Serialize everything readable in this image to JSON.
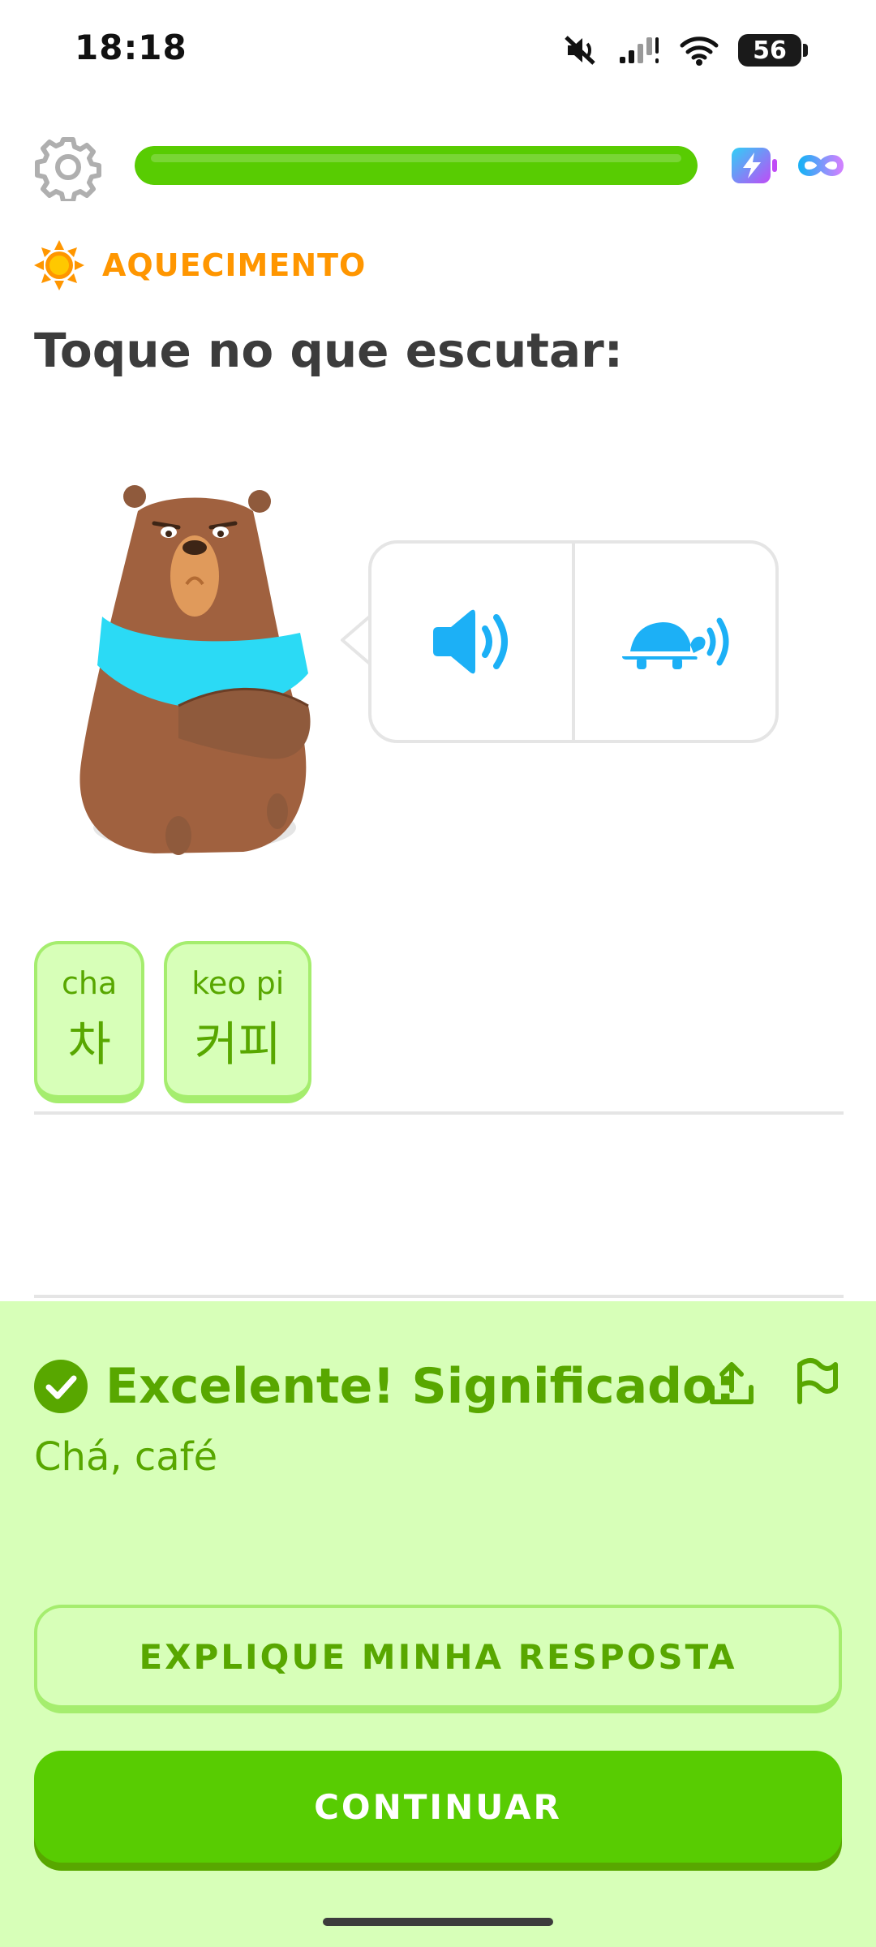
{
  "status_bar": {
    "time": "18:18",
    "battery": "56",
    "icons": [
      "mute-icon",
      "signal-icon",
      "wifi-icon",
      "battery-icon"
    ]
  },
  "top_bar": {
    "progress": 1.0,
    "icons": [
      "gear-icon",
      "energy-icon",
      "infinity-icon"
    ]
  },
  "lesson": {
    "section_label": "AQUECIMENTO",
    "instruction": "Toque no que escutar:",
    "audio_buttons": [
      "speaker-icon",
      "turtle-slow-speaker-icon"
    ]
  },
  "tiles": [
    {
      "romanization": "cha",
      "hangul": "차"
    },
    {
      "romanization": "keo pi",
      "hangul": "커피"
    }
  ],
  "feedback": {
    "title": "Excelente! Significado:",
    "meaning": "Chá, café",
    "explain_label": "EXPLIQUE MINHA RESPOSTA",
    "continue_label": "CONTINUAR"
  },
  "colors": {
    "green": "#58cc02",
    "dark_green": "#58a700",
    "light_green": "#d7ffb8",
    "orange": "#ff9600",
    "blue": "#1cb0f6"
  }
}
